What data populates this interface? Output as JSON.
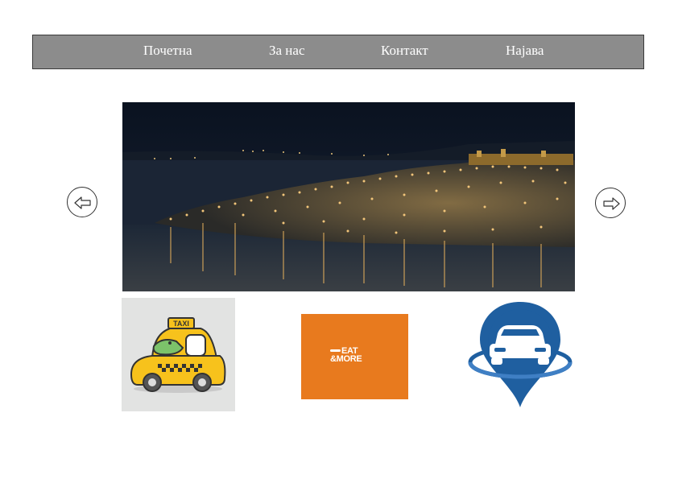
{
  "nav": {
    "items": [
      {
        "label": "Почетна"
      },
      {
        "label": "За нас"
      },
      {
        "label": "Контакт"
      },
      {
        "label": "Најава"
      }
    ]
  },
  "slider": {
    "prev_icon": "arrow-left-icon",
    "next_icon": "arrow-right-icon",
    "image": "night-lakeside-town-photo"
  },
  "tiles": [
    {
      "icon": "taxi-icon",
      "sign": "TAXI"
    },
    {
      "icon": "eat-and-more-logo",
      "line1": "EAT",
      "line2": "&MORE"
    },
    {
      "icon": "car-location-pin-icon"
    }
  ],
  "colors": {
    "navbar": "#8c8c8c",
    "eat_tile": "#e87a1e",
    "pin_blue": "#1f5fa0",
    "taxi_yellow": "#f7c21c"
  }
}
